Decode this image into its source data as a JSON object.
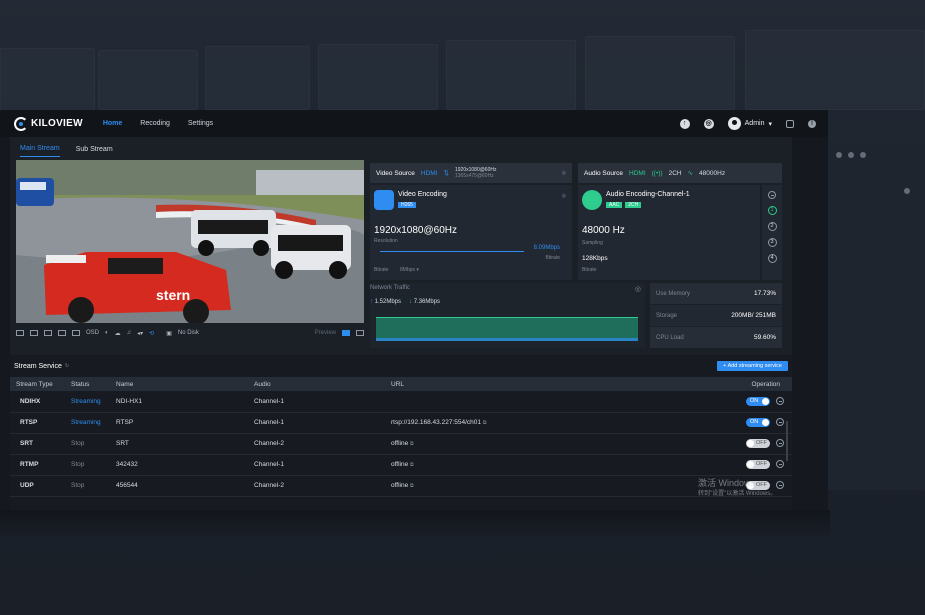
{
  "app": {
    "logo": "KILOVIEW",
    "nav": [
      "Home",
      "Recoding",
      "Settings"
    ],
    "active_nav": "Home",
    "user": "Admin"
  },
  "tabs": [
    "Main Stream",
    "Sub Stream"
  ],
  "video_source": {
    "label": "Video Source",
    "input": "HDMI",
    "res_line1": "1920x1080@60Hz",
    "res_line2": "1365x475@60Hz"
  },
  "video_encoding": {
    "title": "Video Encoding",
    "codec": "H265",
    "resolution": "1920x1080@60Hz",
    "resolution_label": "Resolution",
    "bitrate_value": "8.09Mbps",
    "bitrate_label": "Bitrate",
    "bitrate_setting_label": "Bitrate",
    "bitrate_setting": "8Mbps"
  },
  "audio_source": {
    "label": "Audio Source",
    "input": "HDMI",
    "channels": "2CH",
    "rate": "48000Hz"
  },
  "audio_encoding": {
    "title": "Audio Encoding-Channel-1",
    "codec": "AAC",
    "channels": "2CH",
    "sampling": "48000 Hz",
    "sampling_label": "Sampling",
    "bitrate": "128Kbps",
    "bitrate_label": "Bitrate",
    "channel_buttons": [
      "1",
      "2",
      "3",
      "4"
    ]
  },
  "network": {
    "title": "Network Traffic",
    "up": "1.52Mbps",
    "down": "7.36Mbps"
  },
  "system": [
    {
      "label": "Use Memory",
      "value": "17.73%"
    },
    {
      "label": "Storage",
      "value": "200MB/ 251MB"
    },
    {
      "label": "CPU Load",
      "value": "59.60%"
    }
  ],
  "preview_controls": {
    "osd": "OSD",
    "disk": "No Disk",
    "preview": "Preview"
  },
  "stream_service": {
    "title": "Stream Service",
    "add_button": "+ Add streaming service",
    "columns": [
      "Stream Type",
      "Status",
      "Name",
      "Audio",
      "URL",
      "Operation"
    ],
    "rows": [
      {
        "type": "NDIHX",
        "status": "Streaming",
        "name": "NDI-HX1",
        "audio": "Channel-1",
        "url": "",
        "toggle": "ON"
      },
      {
        "type": "RTSP",
        "status": "Streaming",
        "name": "RTSP",
        "audio": "Channel-1",
        "url": "rtsp://192.168.43.227:554/ch01",
        "toggle": "ON"
      },
      {
        "type": "SRT",
        "status": "Stop",
        "name": "SRT",
        "audio": "Channel-2",
        "url": "offline",
        "toggle": "OFF"
      },
      {
        "type": "RTMP",
        "status": "Stop",
        "name": "342432",
        "audio": "Channel-1",
        "url": "offline",
        "toggle": "OFF"
      },
      {
        "type": "UDP",
        "status": "Stop",
        "name": "456544",
        "audio": "Channel-2",
        "url": "offline",
        "toggle": "OFF"
      }
    ]
  },
  "watermark": {
    "line1": "激活 Windows",
    "line2": "转到\"设置\"以激活 Windows。"
  },
  "colors": {
    "accent": "#2f8cf0",
    "green": "#2ecc8f",
    "background": "#15191f"
  }
}
